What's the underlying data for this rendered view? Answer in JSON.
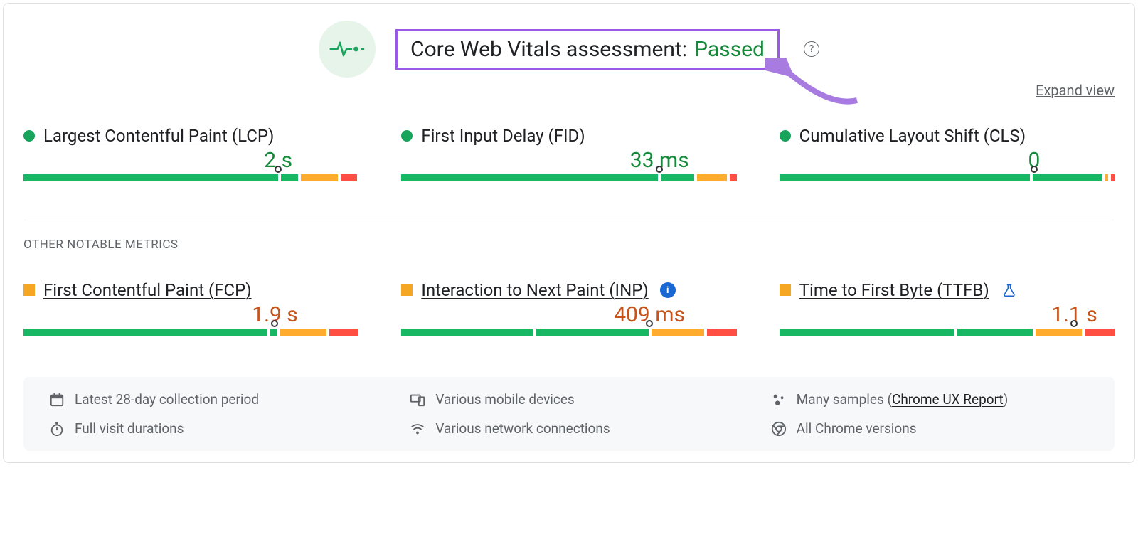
{
  "header": {
    "assessment_label": "Core Web Vitals assessment:",
    "assessment_status": "Passed",
    "expand_view": "Expand view"
  },
  "core_metrics": [
    {
      "name": "Largest Contentful Paint (LCP)",
      "value": "2 s",
      "status": "green",
      "marker_pct": 76,
      "segs": [
        76,
        5,
        11,
        5
      ]
    },
    {
      "name": "First Input Delay (FID)",
      "value": "33 ms",
      "status": "green",
      "marker_pct": 77,
      "segs": [
        77,
        10,
        9,
        2
      ]
    },
    {
      "name": "Cumulative Layout Shift (CLS)",
      "value": "0",
      "status": "green",
      "marker_pct": 76,
      "segs": [
        76,
        21,
        1,
        1
      ]
    }
  ],
  "other_label": "OTHER NOTABLE METRICS",
  "other_metrics": [
    {
      "name": "First Contentful Paint (FCP)",
      "value": "1.9 s",
      "status": "orange",
      "marker_pct": 75,
      "segs": [
        74,
        2,
        14,
        9
      ],
      "badge": null
    },
    {
      "name": "Interaction to Next Paint (INP)",
      "value": "409 ms",
      "status": "orange",
      "marker_pct": 74,
      "segs": [
        40,
        34,
        16,
        9
      ],
      "badge": "info"
    },
    {
      "name": "Time to First Byte (TTFB)",
      "value": "1.1 s",
      "status": "orange",
      "marker_pct": 88,
      "segs": [
        53,
        23,
        14,
        9
      ],
      "badge": "flask"
    }
  ],
  "footer": {
    "period": "Latest 28-day collection period",
    "devices": "Various mobile devices",
    "samples_prefix": "Many samples (",
    "samples_link": "Chrome UX Report",
    "samples_suffix": ")",
    "durations": "Full visit durations",
    "network": "Various network connections",
    "versions": "All Chrome versions"
  },
  "colors": {
    "green": "#148a3a",
    "orange": "#c5531b"
  }
}
